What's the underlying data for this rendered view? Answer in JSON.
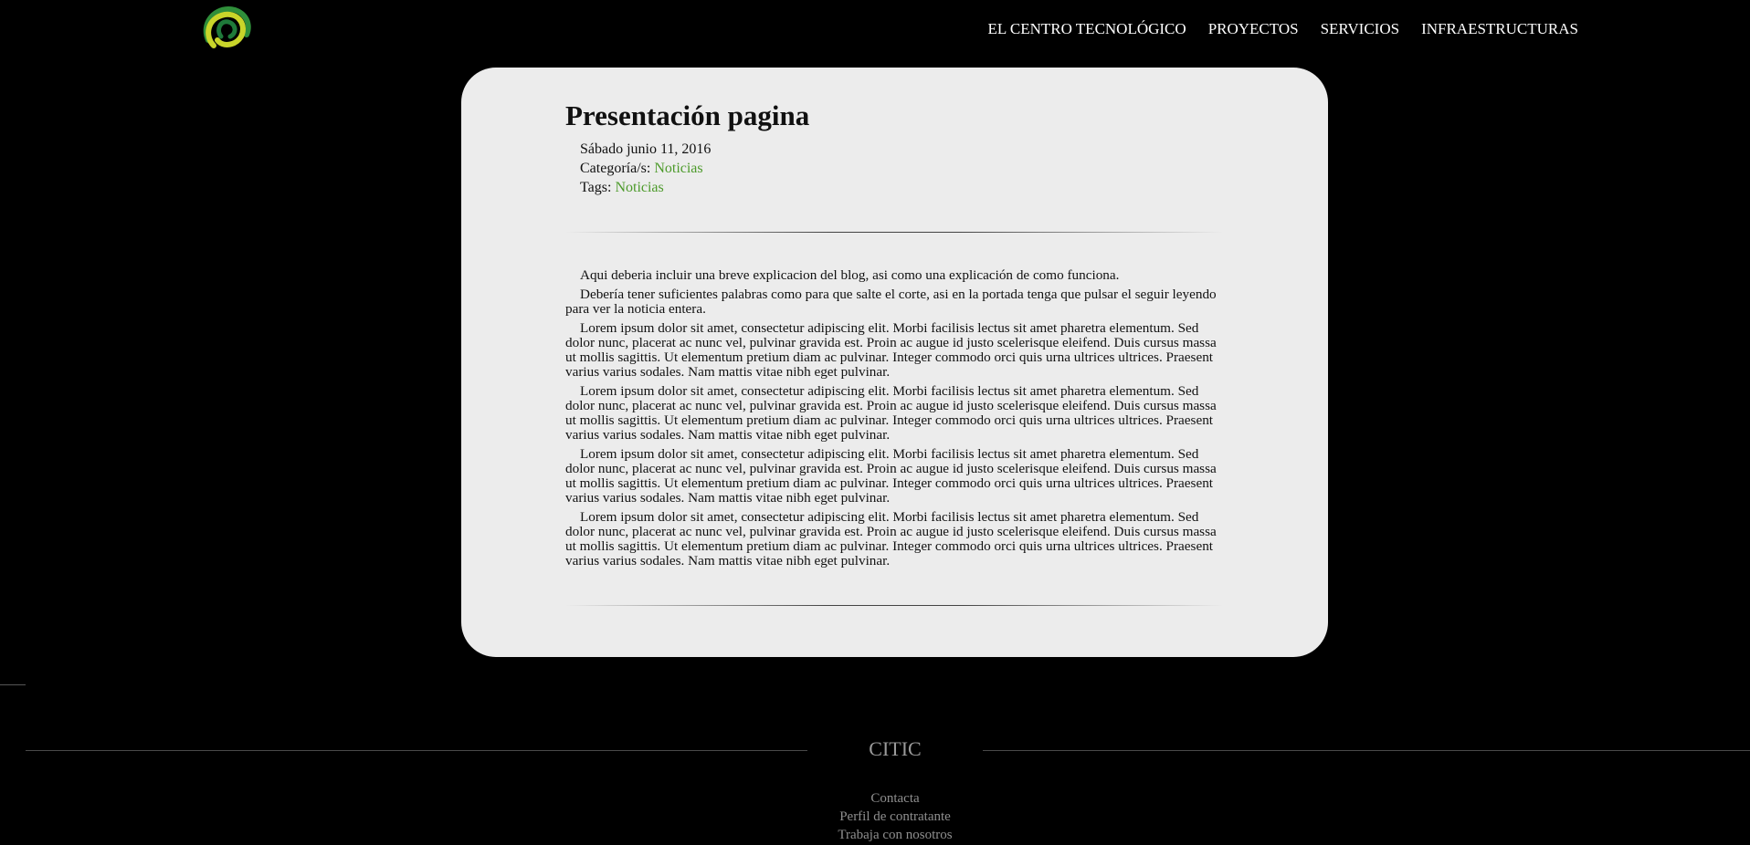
{
  "header": {
    "logo": "citic-logo",
    "nav": [
      {
        "label": "EL CENTRO TECNOLÓGICO"
      },
      {
        "label": "PROYECTOS"
      },
      {
        "label": "SERVICIOS"
      },
      {
        "label": "INFRAESTRUCTURAS"
      }
    ]
  },
  "post": {
    "title": "Presentación pagina",
    "date": "Sábado junio 11, 2016",
    "category_label": "Categoría/s:",
    "category": "Noticias",
    "tags_label": "Tags:",
    "tag": "Noticias",
    "paragraphs": [
      "Aqui deberia incluir una breve explicacion del blog, asi como una explicación de como funciona.",
      "Debería tener suficientes palabras como para que salte el corte, asi en la portada tenga que pulsar el seguir leyendo para ver la noticia entera.",
      "Lorem ipsum dolor sit amet, consectetur adipiscing elit. Morbi facilisis lectus sit amet pharetra elementum. Sed dolor nunc, placerat ac nunc vel, pulvinar gravida est. Proin ac augue id justo scelerisque eleifend. Duis cursus massa ut mollis sagittis. Ut elementum pretium diam ac pulvinar. Integer commodo orci quis urna ultrices ultrices. Praesent varius varius sodales. Nam mattis vitae nibh eget pulvinar.",
      "Lorem ipsum dolor sit amet, consectetur adipiscing elit. Morbi facilisis lectus sit amet pharetra elementum. Sed dolor nunc, placerat ac nunc vel, pulvinar gravida est. Proin ac augue id justo scelerisque eleifend. Duis cursus massa ut mollis sagittis. Ut elementum pretium diam ac pulvinar. Integer commodo orci quis urna ultrices ultrices. Praesent varius varius sodales. Nam mattis vitae nibh eget pulvinar.",
      "Lorem ipsum dolor sit amet, consectetur adipiscing elit. Morbi facilisis lectus sit amet pharetra elementum. Sed dolor nunc, placerat ac nunc vel, pulvinar gravida est. Proin ac augue id justo scelerisque eleifend. Duis cursus massa ut mollis sagittis. Ut elementum pretium diam ac pulvinar. Integer commodo orci quis urna ultrices ultrices. Praesent varius varius sodales. Nam mattis vitae nibh eget pulvinar.",
      "Lorem ipsum dolor sit amet, consectetur adipiscing elit. Morbi facilisis lectus sit amet pharetra elementum. Sed dolor nunc, placerat ac nunc vel, pulvinar gravida est. Proin ac augue id justo scelerisque eleifend. Duis cursus massa ut mollis sagittis. Ut elementum pretium diam ac pulvinar. Integer commodo orci quis urna ultrices ultrices. Praesent varius varius sodales. Nam mattis vitae nibh eget pulvinar."
    ]
  },
  "footer": {
    "brand": "CITIC",
    "links": [
      {
        "label": "Contacta"
      },
      {
        "label": "Perfil de contratante"
      },
      {
        "label": "Trabaja con nosotros"
      }
    ]
  },
  "colors": {
    "background": "#000000",
    "card": "#ececec",
    "link_green": "#4c9a2a",
    "footer_text": "#8f8f8f"
  }
}
